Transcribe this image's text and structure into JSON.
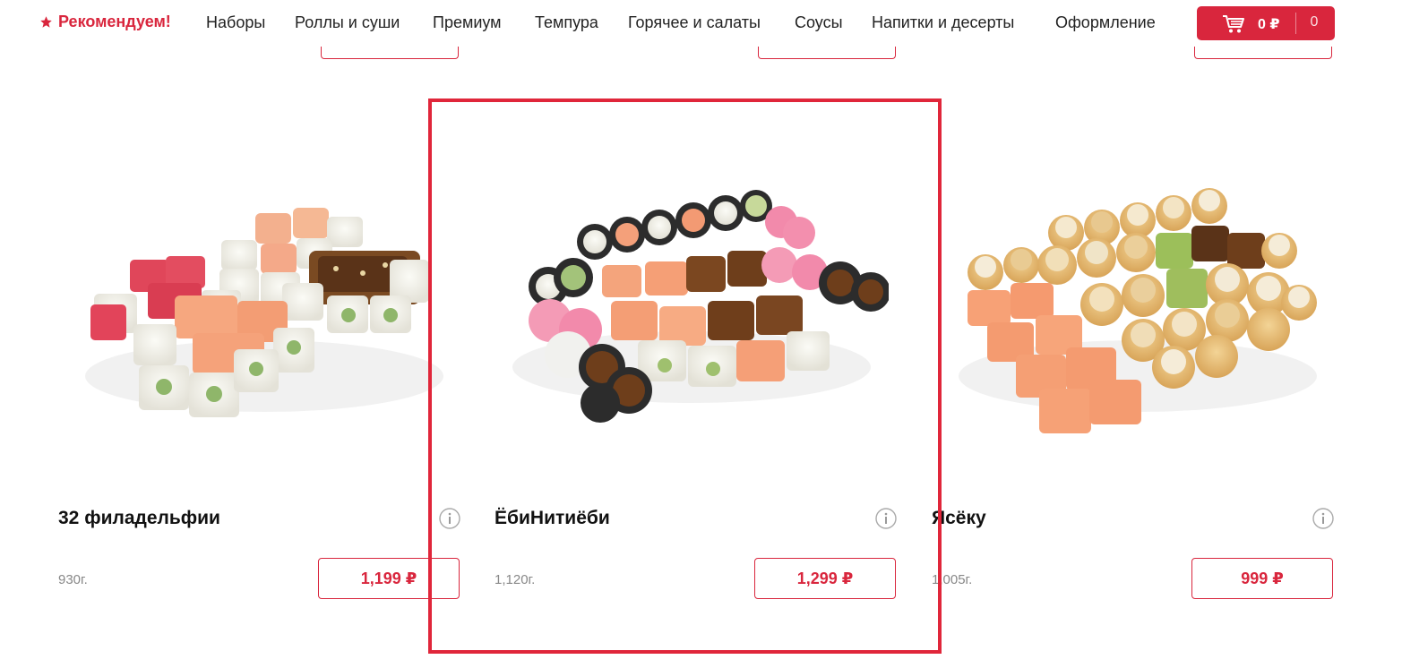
{
  "nav": {
    "recommend_label": "Рекомендуем!",
    "items": [
      "Наборы",
      "Роллы и суши",
      "Премиум",
      "Темпура",
      "Горячее и салаты",
      "Соусы",
      "Напитки и десерты",
      "Оформление"
    ],
    "cart": {
      "sum": "0 ₽",
      "count": "0"
    }
  },
  "products": [
    {
      "title": "32 филадельфии",
      "weight": "930г.",
      "price": "1,199 ₽"
    },
    {
      "title": "ЁбиНитиёби",
      "weight": "1,120г.",
      "price": "1,299 ₽"
    },
    {
      "title": "Ясёку",
      "weight": "1,005г.",
      "price": "999 ₽"
    }
  ],
  "colors": {
    "accent": "#d9263d",
    "highlight": "#e0263a"
  }
}
